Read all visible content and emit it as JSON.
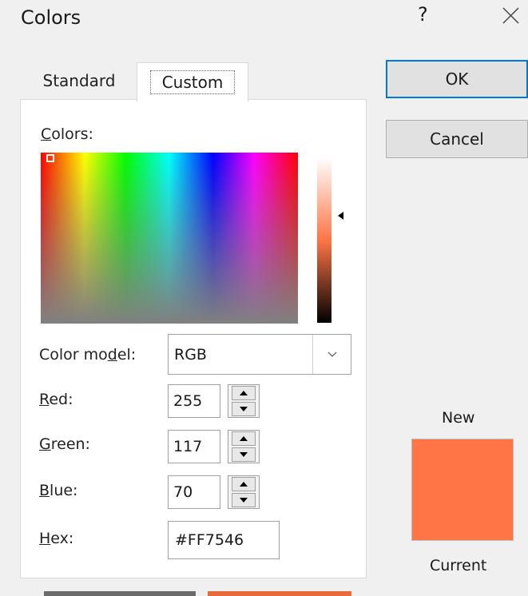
{
  "window": {
    "title": "Colors",
    "help": "?",
    "close_icon": "close-icon"
  },
  "tabs": [
    {
      "label": "Standard"
    },
    {
      "label": "Custom"
    }
  ],
  "buttons": {
    "ok": "OK",
    "cancel": "Cancel"
  },
  "picker": {
    "label_first": "C",
    "label_rest": "olors:"
  },
  "color_model": {
    "label_a": "Color mo",
    "label_u": "d",
    "label_b": "el:",
    "value": "RGB"
  },
  "red": {
    "label_u": "R",
    "label_rest": "ed:",
    "value": "255"
  },
  "green": {
    "label_u": "G",
    "label_rest": "reen:",
    "value": "117"
  },
  "blue": {
    "label_u": "B",
    "label_rest": "lue:",
    "value": "70"
  },
  "hex": {
    "label_u": "H",
    "label_rest": "ex:",
    "value": "#FF7546"
  },
  "preview": {
    "new_label": "New",
    "current_label": "Current",
    "color": "#FF7546"
  },
  "colors": {
    "accent": "#0078d7",
    "selected": "#ff7546"
  }
}
